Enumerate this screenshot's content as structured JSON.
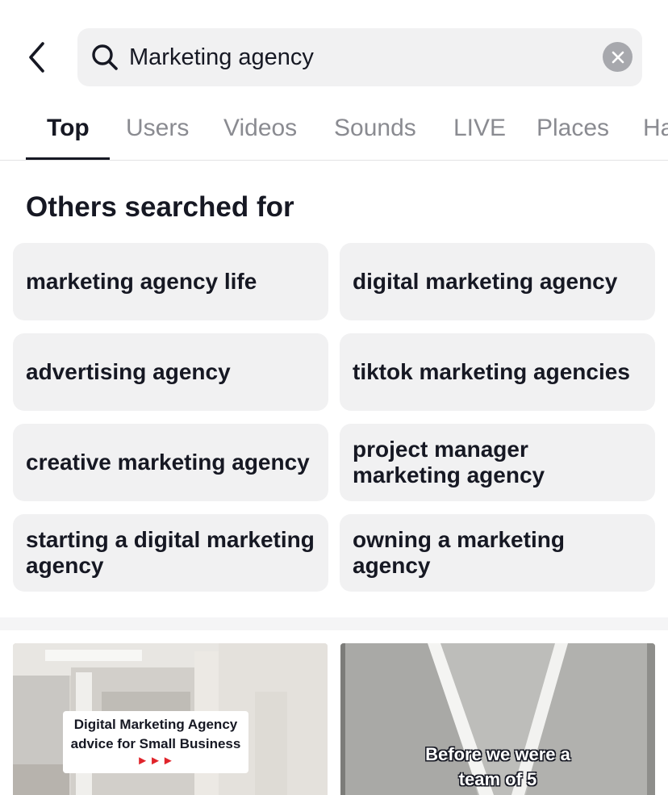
{
  "search": {
    "query": "Marketing agency",
    "icons": {
      "back": "chevron-left-icon",
      "search": "search-icon",
      "clear": "clear-x-icon"
    }
  },
  "tabs": [
    {
      "label": "Top",
      "active": true
    },
    {
      "label": "Users",
      "active": false
    },
    {
      "label": "Videos",
      "active": false
    },
    {
      "label": "Sounds",
      "active": false
    },
    {
      "label": "LIVE",
      "active": false
    },
    {
      "label": "Places",
      "active": false
    },
    {
      "label": "Ha",
      "active": false
    }
  ],
  "others_searched": {
    "title": "Others searched for",
    "items": [
      "marketing agency life",
      "digital marketing agency",
      "advertising agency",
      "tiktok marketing agencies",
      "creative marketing agency",
      "project manager marketing agency",
      "starting a digital marketing agency",
      "owning a marketing agency"
    ]
  },
  "videos": [
    {
      "caption_line1": "Digital Marketing Agency",
      "caption_line2": "advice for Small Business",
      "caption_arrows": "►►►"
    },
    {
      "caption_line1": "Before we were a",
      "caption_line2": "team of 5"
    }
  ],
  "colors": {
    "text_primary": "#161823",
    "text_secondary": "#8a8b91",
    "chip_bg": "#f1f1f2",
    "accent_arrows": "#e0242b"
  }
}
